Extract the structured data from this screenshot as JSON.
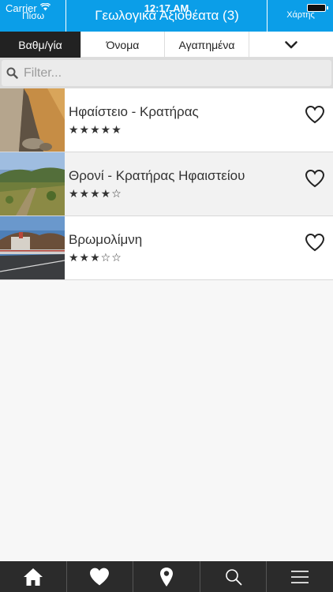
{
  "status_bar": {
    "carrier": "Carrier",
    "time": "12:17 AM"
  },
  "header": {
    "back_label": "Πίσω",
    "title": "Γεωλογικά Αξιοθέατα (3)",
    "map_label": "Χάρτης"
  },
  "sort_tabs": [
    {
      "label": "Βαθμ/γία",
      "active": true
    },
    {
      "label": "Όνομα",
      "active": false
    },
    {
      "label": "Αγαπημένα",
      "active": false
    }
  ],
  "filter": {
    "placeholder": "Filter...",
    "value": ""
  },
  "items": [
    {
      "name": "Ηφαίστειο - Κρατήρας",
      "stars": "★★★★★",
      "rating": 5
    },
    {
      "name": "Θρονί - Κρατήρας Ηφαιστείου",
      "stars": "★★★★☆",
      "rating": 4
    },
    {
      "name": "Βρωμολίμνη",
      "stars": "★★★☆☆",
      "rating": 3
    }
  ],
  "tabbar": {
    "icons": [
      "home-icon",
      "heart-icon",
      "location-pin-icon",
      "search-icon",
      "menu-icon"
    ]
  },
  "colors": {
    "header_bg": "#0b9ee8",
    "active_tab_bg": "#222222",
    "tabbar_bg": "#2b2b2b"
  }
}
